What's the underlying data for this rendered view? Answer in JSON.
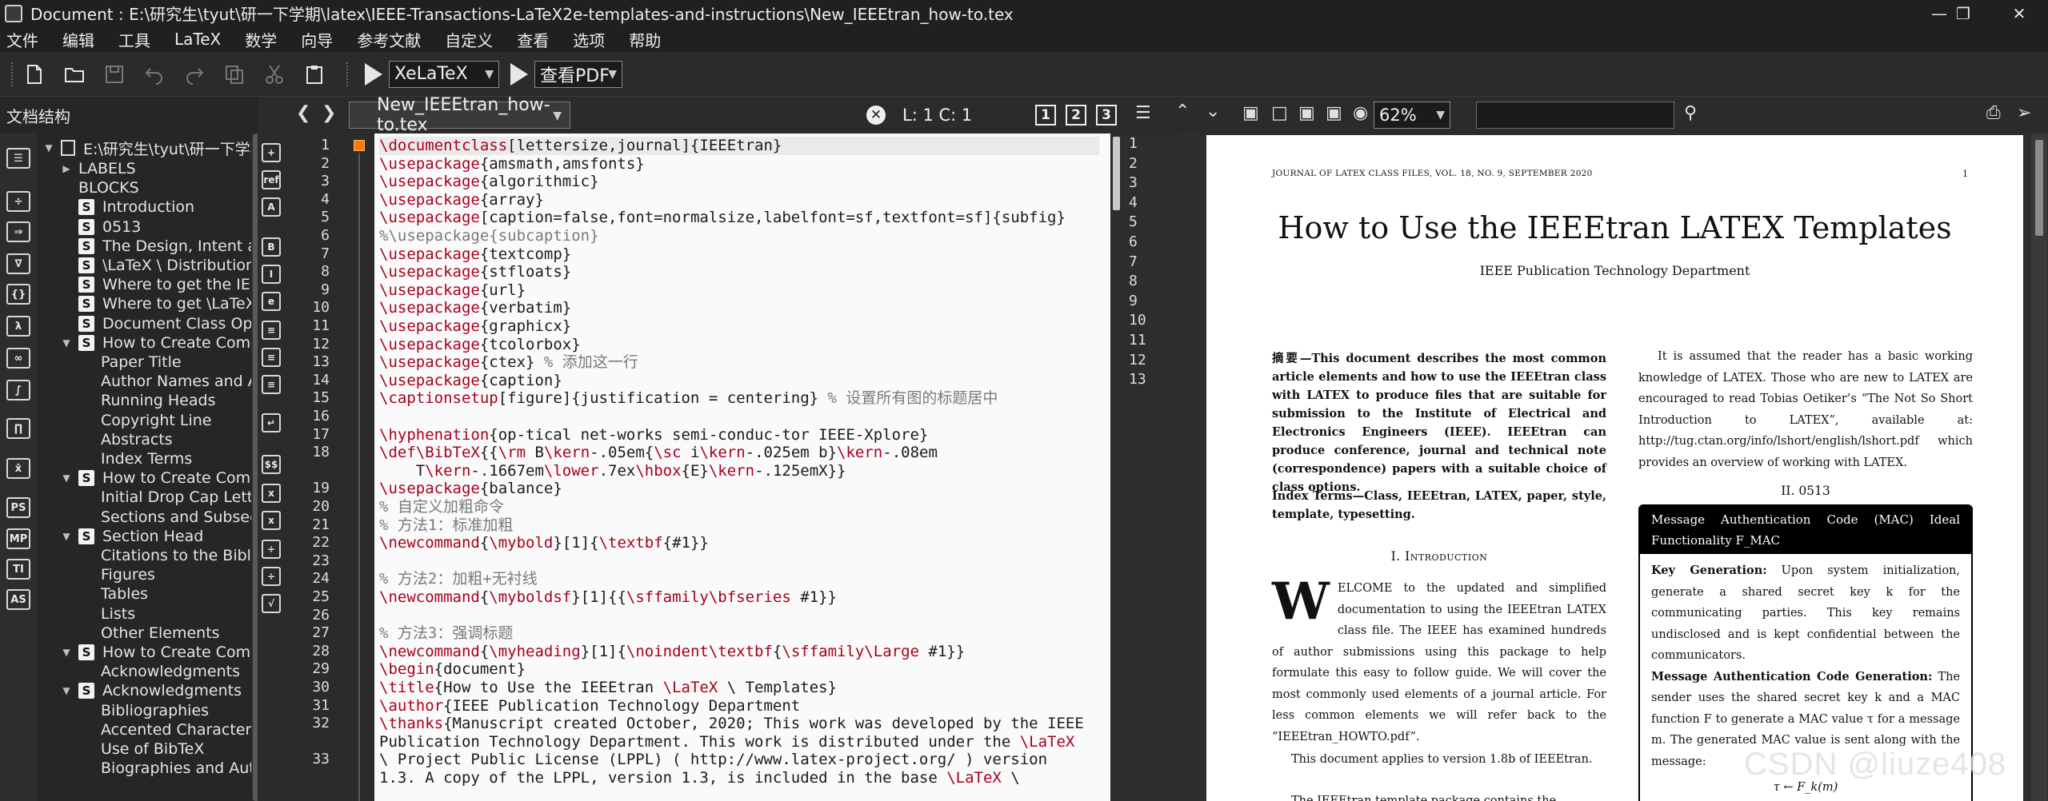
{
  "window": {
    "title": "Document : E:\\研究生\\tyut\\研一下学期\\latex\\IEEE-Transactions-LaTeX2e-templates-and-instructions\\New_IEEEtran_how-to.tex"
  },
  "menu": [
    "文件",
    "编辑",
    "工具",
    "LaTeX",
    "数学",
    "向导",
    "参考文献",
    "自定义",
    "查看",
    "选项",
    "帮助"
  ],
  "toolbar": {
    "compiler": "XeLaTeX",
    "viewer": "查看PDF"
  },
  "structure": {
    "title": "文档结构",
    "root": "E:\\研究生\\tyut\\研一下学期",
    "items": [
      {
        "label": "LABELS",
        "level": 1,
        "toggle": "▶",
        "badge": ""
      },
      {
        "label": "BLOCKS",
        "level": 1,
        "toggle": "",
        "badge": ""
      },
      {
        "label": "Introduction",
        "level": 1,
        "toggle": "",
        "badge": "S"
      },
      {
        "label": "0513",
        "level": 1,
        "toggle": "",
        "badge": "S"
      },
      {
        "label": "The Design, Intent and",
        "level": 1,
        "toggle": "",
        "badge": "S"
      },
      {
        "label": "\\LaTeX \\ Distributions",
        "level": 1,
        "toggle": "",
        "badge": "S"
      },
      {
        "label": "Where to get the IEEEtran",
        "level": 1,
        "toggle": "",
        "badge": "S"
      },
      {
        "label": "Where to get \\LaTeX \\ Help",
        "level": 1,
        "toggle": "",
        "badge": "S"
      },
      {
        "label": "Document Class Options",
        "level": 1,
        "toggle": "",
        "badge": "S"
      },
      {
        "label": "How to Create Common",
        "level": 1,
        "toggle": "▼",
        "badge": "S"
      },
      {
        "label": "Paper Title",
        "level": 2,
        "toggle": "",
        "badge": ""
      },
      {
        "label": "Author Names and Affiliations",
        "level": 2,
        "toggle": "",
        "badge": ""
      },
      {
        "label": "Running Heads",
        "level": 2,
        "toggle": "",
        "badge": ""
      },
      {
        "label": "Copyright Line",
        "level": 2,
        "toggle": "",
        "badge": ""
      },
      {
        "label": "Abstracts",
        "level": 2,
        "toggle": "",
        "badge": ""
      },
      {
        "label": "Index Terms",
        "level": 2,
        "toggle": "",
        "badge": ""
      },
      {
        "label": "How to Create Common",
        "level": 1,
        "toggle": "▼",
        "badge": "S"
      },
      {
        "label": "Initial Drop Cap Letter",
        "level": 2,
        "toggle": "",
        "badge": ""
      },
      {
        "label": "Sections and Subsections",
        "level": 2,
        "toggle": "",
        "badge": ""
      },
      {
        "label": "Section Head",
        "level": 1,
        "toggle": "▼",
        "badge": "S"
      },
      {
        "label": "Citations to the Bibliography",
        "level": 2,
        "toggle": "",
        "badge": ""
      },
      {
        "label": "Figures",
        "level": 2,
        "toggle": "",
        "badge": ""
      },
      {
        "label": "Tables",
        "level": 2,
        "toggle": "",
        "badge": ""
      },
      {
        "label": "Lists",
        "level": 2,
        "toggle": "",
        "badge": ""
      },
      {
        "label": "Other Elements",
        "level": 2,
        "toggle": "",
        "badge": ""
      },
      {
        "label": "How to Create Common",
        "level": 1,
        "toggle": "▼",
        "badge": "S"
      },
      {
        "label": "Acknowledgments",
        "level": 2,
        "toggle": "",
        "badge": ""
      },
      {
        "label": "Acknowledgments",
        "level": 1,
        "toggle": "▼",
        "badge": "S"
      },
      {
        "label": "Bibliographies",
        "level": 2,
        "toggle": "",
        "badge": ""
      },
      {
        "label": "Accented Characters",
        "level": 2,
        "toggle": "",
        "badge": ""
      },
      {
        "label": "Use of BibTeX",
        "level": 2,
        "toggle": "",
        "badge": ""
      },
      {
        "label": "Biographies and Author",
        "level": 2,
        "toggle": "",
        "badge": ""
      }
    ]
  },
  "editor": {
    "tab": "New_IEEEtran_how-to.tex",
    "cursor": "L: 1 C: 1",
    "views": [
      "1",
      "2",
      "3"
    ],
    "lines": [
      {
        "n": "1",
        "t": "\\documentclass[lettersize,journal]{IEEEtran}"
      },
      {
        "n": "2",
        "t": "\\usepackage{amsmath,amsfonts}"
      },
      {
        "n": "3",
        "t": "\\usepackage{algorithmic}"
      },
      {
        "n": "4",
        "t": "\\usepackage{array}"
      },
      {
        "n": "5",
        "t": "\\usepackage[caption=false,font=normalsize,labelfont=sf,textfont=sf]{subfig}"
      },
      {
        "n": "6",
        "t": "%\\usepackage{subcaption}"
      },
      {
        "n": "7",
        "t": "\\usepackage{textcomp}"
      },
      {
        "n": "8",
        "t": "\\usepackage{stfloats}"
      },
      {
        "n": "9",
        "t": "\\usepackage{url}"
      },
      {
        "n": "10",
        "t": "\\usepackage{verbatim}"
      },
      {
        "n": "11",
        "t": "\\usepackage{graphicx}"
      },
      {
        "n": "12",
        "t": "\\usepackage{tcolorbox}"
      },
      {
        "n": "13",
        "t": "\\usepackage{ctex} % 添加这一行"
      },
      {
        "n": "14",
        "t": "\\usepackage{caption}"
      },
      {
        "n": "15",
        "t": "\\captionsetup[figure]{justification = centering} % 设置所有图的标题居中"
      },
      {
        "n": "16",
        "t": ""
      },
      {
        "n": "17",
        "t": "\\hyphenation{op-tical net-works semi-conduc-tor IEEE-Xplore}"
      },
      {
        "n": "18",
        "t": "\\def\\BibTeX{{\\rm B\\kern-.05em{\\sc i\\kern-.025em b}\\kern-.08em"
      },
      {
        "n": "",
        "t": "    T\\kern-.1667em\\lower.7ex\\hbox{E}\\kern-.125emX}}"
      },
      {
        "n": "19",
        "t": "\\usepackage{balance}"
      },
      {
        "n": "20",
        "t": "% 自定义加粗命令"
      },
      {
        "n": "21",
        "t": "% 方法1：标准加粗"
      },
      {
        "n": "22",
        "t": "\\newcommand{\\mybold}[1]{\\textbf{#1}}"
      },
      {
        "n": "23",
        "t": ""
      },
      {
        "n": "24",
        "t": "% 方法2：加粗+无衬线"
      },
      {
        "n": "25",
        "t": "\\newcommand{\\myboldsf}[1]{{\\sffamily\\bfseries #1}}"
      },
      {
        "n": "26",
        "t": ""
      },
      {
        "n": "27",
        "t": "% 方法3：强调标题"
      },
      {
        "n": "28",
        "t": "\\newcommand{\\myheading}[1]{\\noindent\\textbf{\\sffamily\\Large #1}}"
      },
      {
        "n": "29",
        "t": "\\begin{document}"
      },
      {
        "n": "30",
        "t": "\\title{How to Use the IEEEtran \\LaTeX \\ Templates}"
      },
      {
        "n": "31",
        "t": "\\author{IEEE Publication Technology Department"
      },
      {
        "n": "32",
        "t": "\\thanks{Manuscript created October, 2020; This work was developed by the IEEE"
      },
      {
        "n": "",
        "t": "Publication Technology Department. This work is distributed under the \\LaTeX"
      },
      {
        "n": "33",
        "t": "\\ Project Public License (LPPL) ( http://www.latex-project.org/ ) version"
      },
      {
        "n": "",
        "t": "1.3. A copy of the LPPL, version 1.3, is included in the base \\LaTeX \\"
      }
    ]
  },
  "pdf": {
    "zoom": "62%",
    "line_numbers": [
      "1",
      "2",
      "3",
      "4",
      "5",
      "6",
      "7",
      "8",
      "9",
      "10",
      "11",
      "12",
      "13"
    ],
    "journal_header": "JOURNAL OF LATEX CLASS FILES, VOL. 18, NO. 9, SEPTEMBER 2020",
    "page_number": "1",
    "title": "How to Use the IEEEtran LATEX Templates",
    "author": "IEEE Publication Technology Department",
    "abstract": "摘要—This document describes the most common article elements and how to use the IEEEtran class with LATEX to produce files that are suitable for submission to the Institute of Electrical and Electronics Engineers (IEEE). IEEEtran can produce conference, journal and technical note (correspondence) papers with a suitable choice of class options.",
    "index_terms": "Index Terms—Class, IEEEtran, LATEX, paper, style, template, typesetting.",
    "section1": "I. Introduction",
    "dropcap": "W",
    "body1": "ELCOME to the updated and simplified documentation to using the IEEEtran LATEX class file. The IEEE has examined hundreds of author submissions using this package to help formulate this easy to follow guide. We will cover the most commonly used elements of a journal article. For less common elements we will refer back to the “IEEEtran_HOWTO.pdf”.",
    "body2": "This document applies to version 1.8b of IEEEtran.",
    "body3": "The IEEEtran template package contains the following",
    "right_para": "It is assumed that the reader has a basic working knowledge of LATEX. Those who are new to LATEX are encouraged to read Tobias Oetiker’s “The Not So Short Introduction to LATEX”, available at: http://tug.ctan.org/info/lshort/english/lshort.pdf which provides an overview of working with LATEX.",
    "section2": "II. 0513",
    "box_title": "Message Authentication Code (MAC) Ideal Functionality F_MAC",
    "box_key_label": "Key Generation:",
    "box_key_text": "Upon system initialization, generate a shared secret key k for the communicating parties. This key remains undisclosed and is kept confidential between the communicators.",
    "box_mac_label": "Message Authentication Code Generation:",
    "box_mac_text": "The sender uses the shared secret key k and a MAC function F to generate a MAC value τ for a message m. The generated MAC value is sent along with the message:",
    "box_formula": "τ ← F_k(m)"
  },
  "watermark": "CSDN @liuze408"
}
